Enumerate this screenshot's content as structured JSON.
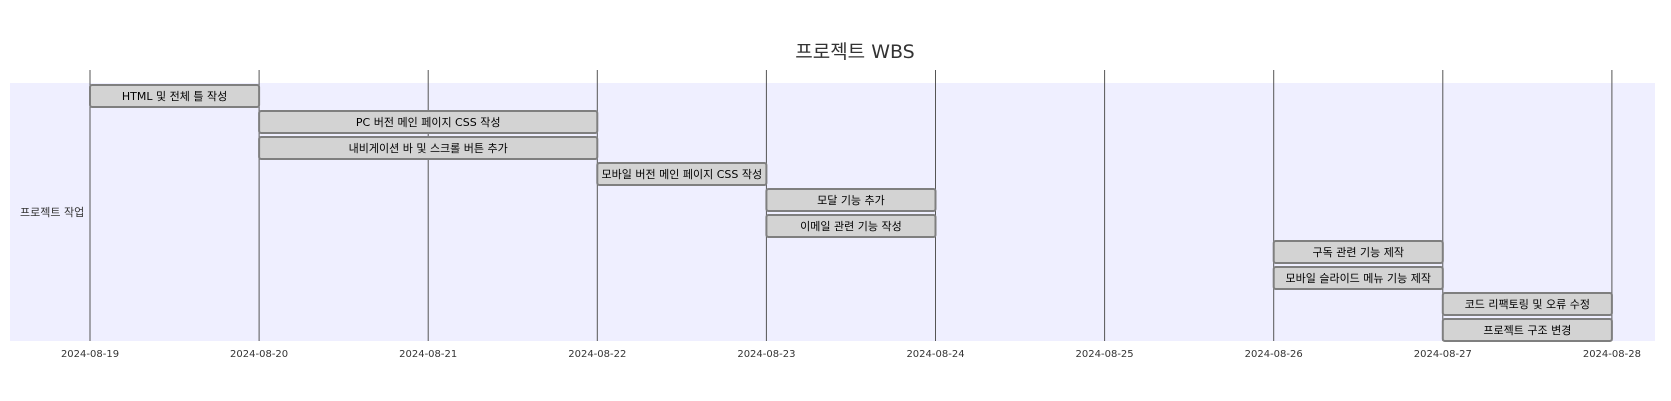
{
  "chart_data": {
    "type": "gantt",
    "title": "프로젝트 WBS",
    "section": "프로젝트 작업",
    "xaxis": {
      "range": [
        "2024-08-19",
        "2024-08-28"
      ],
      "ticks": [
        "2024-08-19",
        "2024-08-20",
        "2024-08-21",
        "2024-08-22",
        "2024-08-23",
        "2024-08-24",
        "2024-08-25",
        "2024-08-26",
        "2024-08-27",
        "2024-08-28"
      ]
    },
    "grid": true,
    "tasks": [
      {
        "name": "HTML 및 전체 틀 작성",
        "start": "2024-08-19",
        "end": "2024-08-20"
      },
      {
        "name": "PC 버전 메인 페이지 CSS 작성",
        "start": "2024-08-20",
        "end": "2024-08-22"
      },
      {
        "name": "내비게이션 바 및 스크롤 버튼 추가",
        "start": "2024-08-20",
        "end": "2024-08-22"
      },
      {
        "name": "모바일 버전 메인 페이지 CSS 작성",
        "start": "2024-08-22",
        "end": "2024-08-23"
      },
      {
        "name": "모달 기능 추가",
        "start": "2024-08-23",
        "end": "2024-08-24"
      },
      {
        "name": "이메일 관련 기능 작성",
        "start": "2024-08-23",
        "end": "2024-08-24"
      },
      {
        "name": "구독 관련 기능 제작",
        "start": "2024-08-26",
        "end": "2024-08-27"
      },
      {
        "name": "모바일 슬라이드 메뉴 기능 제작",
        "start": "2024-08-26",
        "end": "2024-08-27"
      },
      {
        "name": "코드 리팩토링 및 오류 수정",
        "start": "2024-08-27",
        "end": "2024-08-28"
      },
      {
        "name": "프로젝트 구조 변경",
        "start": "2024-08-27",
        "end": "2024-08-28"
      }
    ],
    "colors": {
      "section_background": "#efefff",
      "bar_fill": "#d3d3d3",
      "bar_stroke": "#7f7f7f",
      "grid": "#555555",
      "text": "#333333"
    }
  }
}
